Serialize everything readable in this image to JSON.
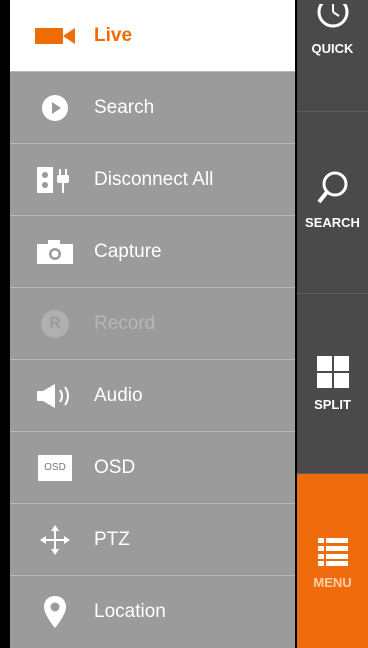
{
  "menu": {
    "items": [
      {
        "label": "Live",
        "icon": "camera-icon",
        "state": "active"
      },
      {
        "label": "Search",
        "icon": "play-icon",
        "state": "normal"
      },
      {
        "label": "Disconnect All",
        "icon": "plug-icon",
        "state": "normal"
      },
      {
        "label": "Capture",
        "icon": "capture-camera-icon",
        "state": "normal"
      },
      {
        "label": "Record",
        "icon": "record-icon",
        "state": "disabled"
      },
      {
        "label": "Audio",
        "icon": "speaker-icon",
        "state": "normal"
      },
      {
        "label": "OSD",
        "icon": "osd-icon",
        "state": "normal"
      },
      {
        "label": "PTZ",
        "icon": "move-arrows-icon",
        "state": "normal"
      },
      {
        "label": "Location",
        "icon": "location-pin-icon",
        "state": "normal"
      }
    ],
    "record_badge": "R",
    "osd_badge": "OSD"
  },
  "toolbar": {
    "quick": "QUICK",
    "search": "SEARCH",
    "split": "SPLIT",
    "menu": "MENU"
  },
  "colors": {
    "accent": "#f06b0c",
    "menu_bg": "#9b9b9b",
    "toolbar_bg": "#4a4a4a",
    "active_bg": "#ffffff"
  }
}
